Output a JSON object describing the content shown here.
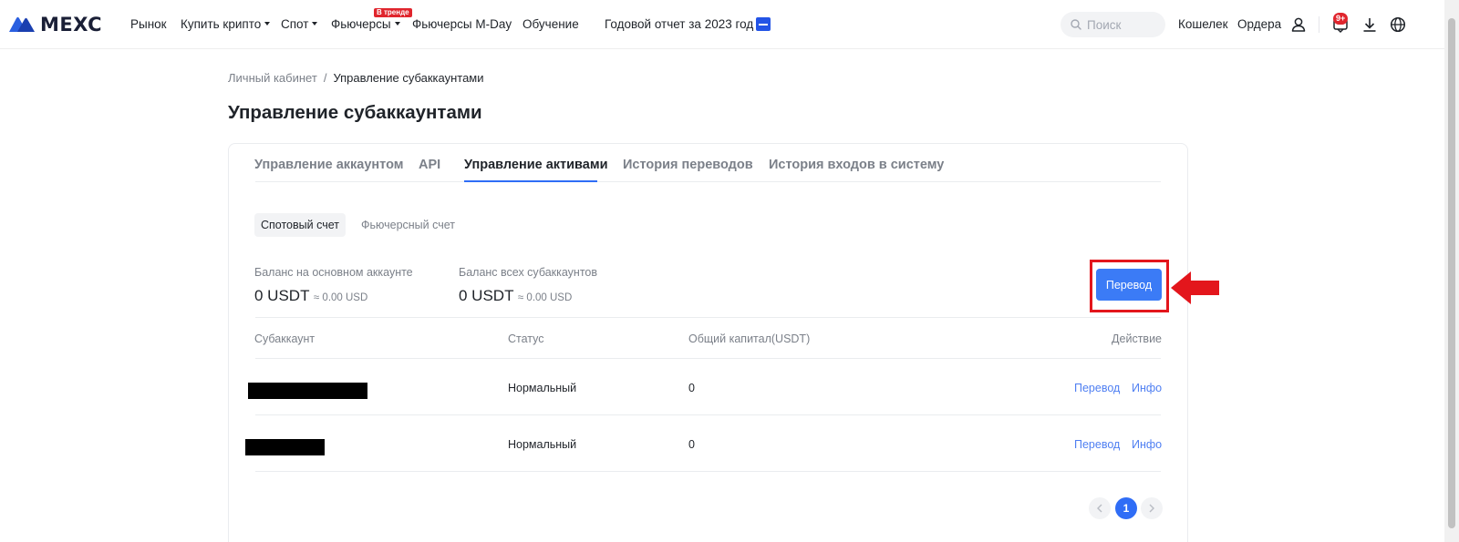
{
  "header": {
    "logo_text": "MEXC",
    "nav": [
      {
        "label": "Рынок"
      },
      {
        "label": "Купить крипто"
      },
      {
        "label": "Спот"
      },
      {
        "label": "Фьючерсы"
      },
      {
        "label": "Фьючерсы M-Day"
      },
      {
        "label": "Обучение"
      },
      {
        "label": "Годовой отчет за 2023 год"
      }
    ],
    "trend_badge": "В тренде",
    "search_placeholder": "Поиск",
    "wallet_label": "Кошелек",
    "orders_label": "Ордера",
    "notification_count": "9+"
  },
  "breadcrumb": {
    "parent": "Личный кабинет",
    "separator": "/",
    "current": "Управление субаккаунтами"
  },
  "page_title": "Управление субаккаунтами",
  "tabs": [
    {
      "label": "Управление аккаунтом",
      "active": false
    },
    {
      "label": "API",
      "active": false
    },
    {
      "label": "Управление активами",
      "active": true
    },
    {
      "label": "История переводов",
      "active": false
    },
    {
      "label": "История входов в систему",
      "active": false
    }
  ],
  "subtabs": [
    {
      "label": "Спотовый счет",
      "active": true
    },
    {
      "label": "Фьючерсный счет",
      "active": false
    }
  ],
  "balances": {
    "main": {
      "label": "Баланс на основном аккаунте",
      "value": "0 USDT",
      "approx": "≈ 0.00 USD"
    },
    "subs": {
      "label": "Баланс всех субаккаунтов",
      "value": "0 USDT",
      "approx": "≈ 0.00 USD"
    }
  },
  "transfer_button": "Перевод",
  "table": {
    "headers": [
      "Субаккаунт",
      "Статус",
      "Общий капитал(USDT)",
      "Действие"
    ],
    "rows": [
      {
        "account": "",
        "status": "Нормальный",
        "capital": "0",
        "actions": [
          "Перевод",
          "Инфо"
        ]
      },
      {
        "account": "",
        "status": "Нормальный",
        "capital": "0",
        "actions": [
          "Перевод",
          "Инфо"
        ]
      }
    ]
  },
  "pagination": {
    "current_page": "1"
  },
  "colors": {
    "accent": "#2f6df6",
    "button": "#3b7bf6",
    "link": "#4f7ff2",
    "highlight": "#e3161c",
    "badge": "#e0252d"
  }
}
